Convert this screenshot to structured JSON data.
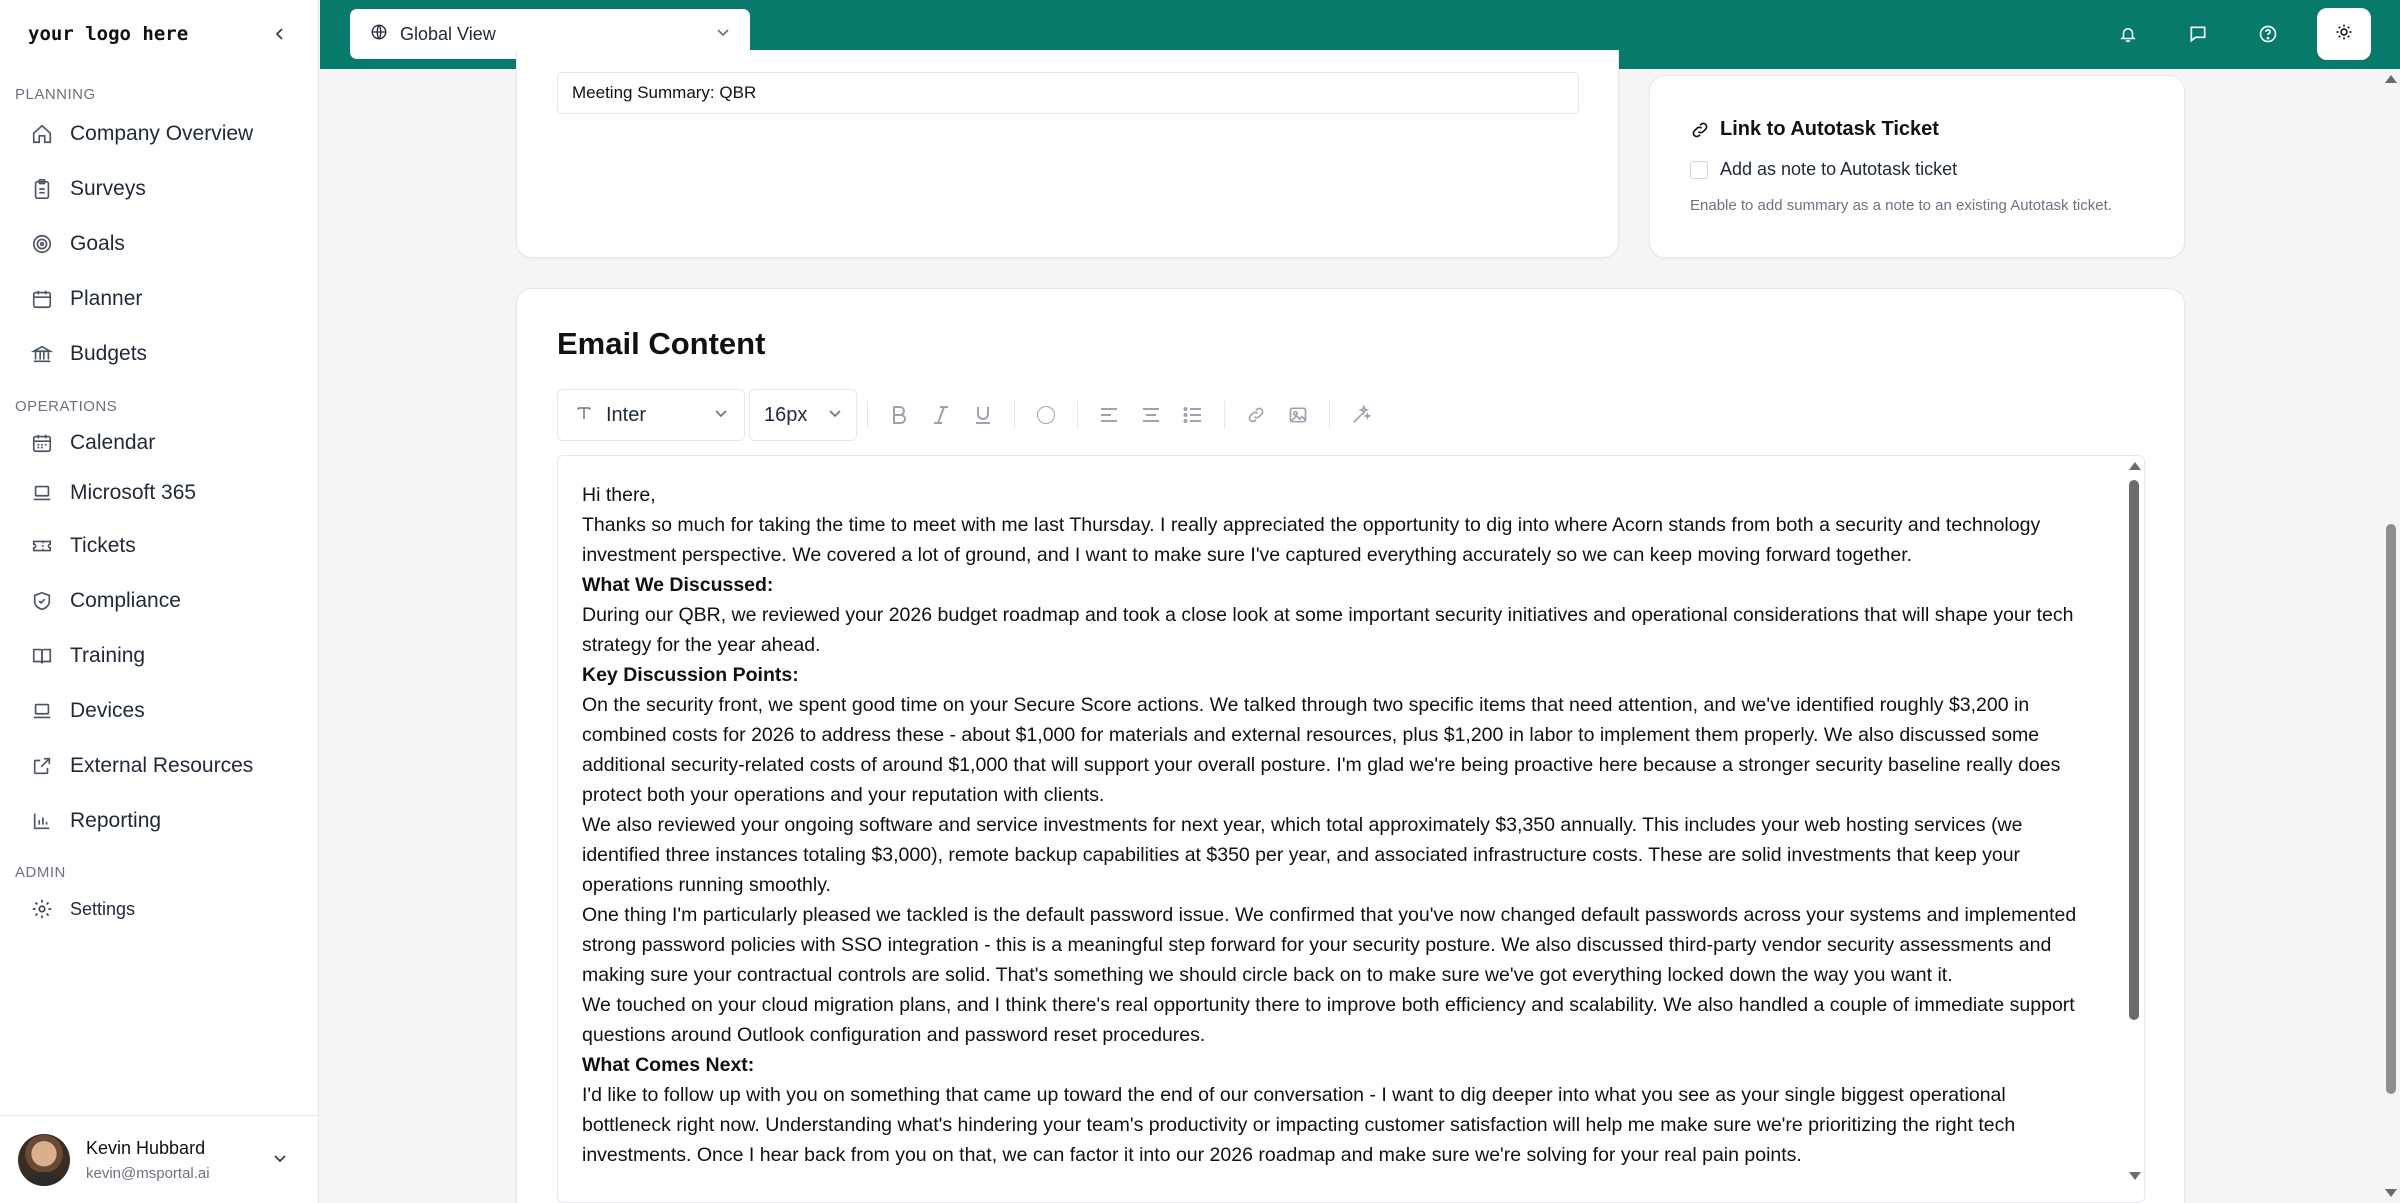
{
  "colors": {
    "topbar": "#087a6b",
    "accent": "#087a6b"
  },
  "sidebar": {
    "logo": "your logo here",
    "sections": {
      "planning": "PLANNING",
      "operations": "OPERATIONS",
      "admin": "ADMIN"
    },
    "items": [
      {
        "label": "Company Overview",
        "icon": "home-icon"
      },
      {
        "label": "Surveys",
        "icon": "clipboard-icon"
      },
      {
        "label": "Goals",
        "icon": "target-icon"
      },
      {
        "label": "Planner",
        "icon": "calendar-icon"
      },
      {
        "label": "Budgets",
        "icon": "bank-icon"
      },
      {
        "label": "Calendar",
        "icon": "calendar-grid-icon"
      },
      {
        "label": "Microsoft 365",
        "icon": "laptop-icon"
      },
      {
        "label": "Tickets",
        "icon": "ticket-icon"
      },
      {
        "label": "Compliance",
        "icon": "shield-icon"
      },
      {
        "label": "Training",
        "icon": "book-icon"
      },
      {
        "label": "Devices",
        "icon": "laptop-icon"
      },
      {
        "label": "External Resources",
        "icon": "external-link-icon"
      },
      {
        "label": "Reporting",
        "icon": "bar-chart-icon"
      },
      {
        "label": "Settings",
        "icon": "gear-icon"
      }
    ],
    "user": {
      "name": "Kevin Hubbard",
      "email": "kevin@msportal.ai"
    }
  },
  "topbar": {
    "view_label": "Global View"
  },
  "subject": {
    "value": "Meeting Summary: QBR"
  },
  "autotask": {
    "title": "Link to Autotask Ticket",
    "checkbox_label": "Add as note to Autotask ticket",
    "help": "Enable to add summary as a note to an existing Autotask ticket."
  },
  "email": {
    "title": "Email Content",
    "font": "Inter",
    "size": "16px",
    "lines": [
      {
        "text": "Hi there,",
        "bold": false
      },
      {
        "text": "Thanks so much for taking the time to meet with me last Thursday. I really appreciated the opportunity to dig into where Acorn stands from both a security and technology investment perspective. We covered a lot of ground, and I want to make sure I've captured everything accurately so we can keep moving forward together.",
        "bold": false
      },
      {
        "text": "What We Discussed:",
        "bold": true
      },
      {
        "text": "During our QBR, we reviewed your 2026 budget roadmap and took a close look at some important security initiatives and operational considerations that will shape your tech strategy for the year ahead.",
        "bold": false
      },
      {
        "text": "Key Discussion Points:",
        "bold": true
      },
      {
        "text": "On the security front, we spent good time on your Secure Score actions. We talked through two specific items that need attention, and we've identified roughly $3,200 in combined costs for 2026 to address these - about $1,000 for materials and external resources, plus $1,200 in labor to implement them properly. We also discussed some additional security-related costs of around $1,000 that will support your overall posture. I'm glad we're being proactive here because a stronger security baseline really does protect both your operations and your reputation with clients.",
        "bold": false
      },
      {
        "text": "We also reviewed your ongoing software and service investments for next year, which total approximately $3,350 annually. This includes your web hosting services (we identified three instances totaling $3,000), remote backup capabilities at $350 per year, and associated infrastructure costs. These are solid investments that keep your operations running smoothly.",
        "bold": false
      },
      {
        "text": "One thing I'm particularly pleased we tackled is the default password issue. We confirmed that you've now changed default passwords across your systems and implemented strong password policies with SSO integration - this is a meaningful step forward for your security posture. We also discussed third-party vendor security assessments and making sure your contractual controls are solid. That's something we should circle back on to make sure we've got everything locked down the way you want it.",
        "bold": false
      },
      {
        "text": "We touched on your cloud migration plans, and I think there's real opportunity there to improve both efficiency and scalability. We also handled a couple of immediate support questions around Outlook configuration and password reset procedures.",
        "bold": false
      },
      {
        "text": "What Comes Next:",
        "bold": true
      },
      {
        "text": "I'd like to follow up with you on something that came up toward the end of our conversation - I want to dig deeper into what you see as your single biggest operational bottleneck right now. Understanding what's hindering your team's productivity or impacting customer satisfaction will help me make sure we're prioritizing the right tech investments. Once I hear back from you on that, we can factor it into our 2026 roadmap and make sure we're solving for your real pain points.",
        "bold": false
      }
    ]
  }
}
